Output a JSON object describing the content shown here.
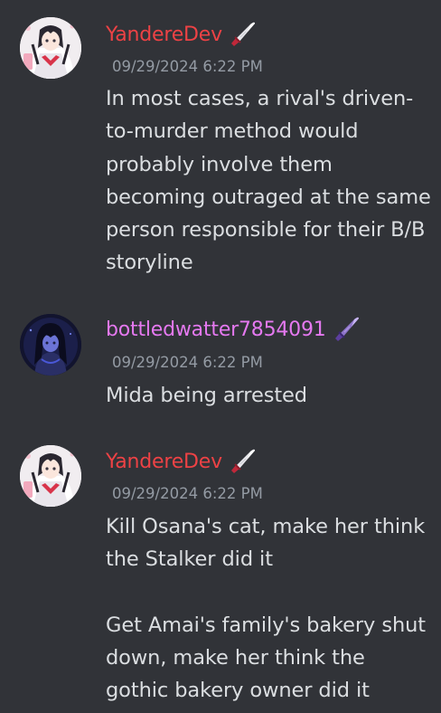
{
  "colors": {
    "background": "#313338",
    "username_yanderedev": "#ed4245",
    "username_bottled": "#e579f0",
    "timestamp": "#949ba4",
    "text": "#dbdee1"
  },
  "messages": [
    {
      "username": "YandereDev",
      "role_icon": "knife-icon",
      "timestamp": "09/29/2024 6:22 PM",
      "content": "In most cases, a rival's driven-to-murder method would probably involve them becoming outraged at the same person responsible for their B/B storyline"
    },
    {
      "username": "bottledwatter7854091",
      "role_icon": "purple-knife-icon",
      "timestamp": "09/29/2024 6:22 PM",
      "content": "Mida being arrested"
    },
    {
      "username": "YandereDev",
      "role_icon": "knife-icon",
      "timestamp": "09/29/2024 6:22 PM",
      "content": "Kill Osana's cat, make her think the Stalker did it\n\nGet Amai's family's bakery shut down, make her think the gothic bakery owner did it"
    }
  ]
}
